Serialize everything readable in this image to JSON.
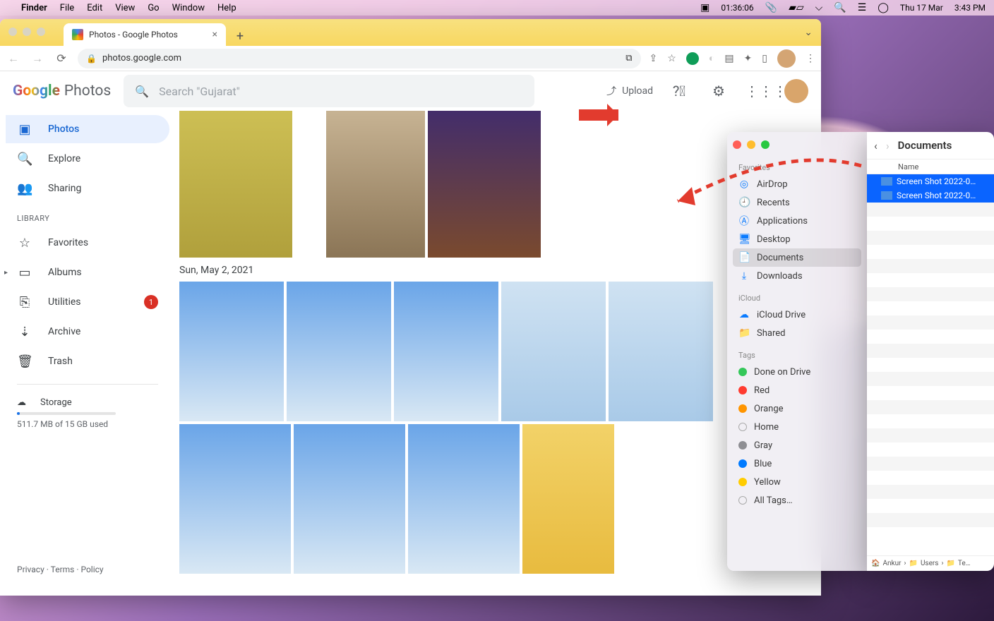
{
  "menubar": {
    "app": "Finder",
    "menus": [
      "File",
      "Edit",
      "View",
      "Go",
      "Window",
      "Help"
    ],
    "clock_24": "01:36:06",
    "date": "Thu 17 Mar",
    "time": "3:43 PM"
  },
  "chrome": {
    "tab_title": "Photos - Google Photos",
    "url": "photos.google.com"
  },
  "gphotos": {
    "logo_google": "Google",
    "logo_photos": "Photos",
    "search_placeholder": "Search \"Gujarat\"",
    "upload": "Upload",
    "sidebar": {
      "photos": "Photos",
      "explore": "Explore",
      "sharing": "Sharing",
      "library_header": "LIBRARY",
      "favorites": "Favorites",
      "albums": "Albums",
      "utilities": "Utilities",
      "utilities_badge": "1",
      "archive": "Archive",
      "trash": "Trash",
      "storage": "Storage",
      "storage_used": "511.7 MB of 15 GB used",
      "footer_privacy": "Privacy",
      "footer_terms": "Terms",
      "footer_policy": "Policy"
    },
    "date_header": "Sun, May 2, 2021"
  },
  "finder_sidebar": {
    "favorites_header": "Favorites",
    "favorites": [
      "AirDrop",
      "Recents",
      "Applications",
      "Desktop",
      "Documents",
      "Downloads"
    ],
    "selected_favorite": "Documents",
    "icloud_header": "iCloud",
    "icloud": [
      "iCloud Drive",
      "Shared"
    ],
    "tags_header": "Tags",
    "tags": [
      {
        "name": "Done on Drive",
        "color": "#34c759"
      },
      {
        "name": "Red",
        "color": "#ff3b30"
      },
      {
        "name": "Orange",
        "color": "#ff9500"
      },
      {
        "name": "Home",
        "color": "transparent"
      },
      {
        "name": "Gray",
        "color": "#8e8e93"
      },
      {
        "name": "Blue",
        "color": "#007aff"
      },
      {
        "name": "Yellow",
        "color": "#ffcc00"
      },
      {
        "name": "All Tags…",
        "color": "transparent"
      }
    ]
  },
  "finder_main": {
    "title": "Documents",
    "column_name": "Name",
    "files": [
      "Screen Shot 2022-0…",
      "Screen Shot 2022-0…"
    ],
    "path": [
      "Ankur",
      "Users",
      "Te…"
    ]
  }
}
